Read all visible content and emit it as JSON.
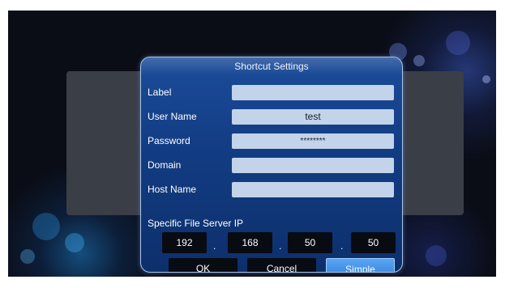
{
  "dialog": {
    "title": "Shortcut Settings",
    "fields": [
      {
        "label": "Label",
        "value": ""
      },
      {
        "label": "User Name",
        "value": "test"
      },
      {
        "label": "Password",
        "value": "********"
      },
      {
        "label": "Domain",
        "value": ""
      },
      {
        "label": "Host Name",
        "value": ""
      }
    ],
    "ip": {
      "label": "Specific File Server IP",
      "octets": [
        "192",
        "168",
        "50",
        "50"
      ],
      "separator": "."
    },
    "buttons": {
      "ok": "OK",
      "cancel": "Cancel",
      "simple": "Simple"
    }
  },
  "colors": {
    "dialog_bg": "#123c82",
    "field_bg": "#c2d3ea",
    "button_bg": "#080b12",
    "active_button": "#3a8ae6"
  }
}
